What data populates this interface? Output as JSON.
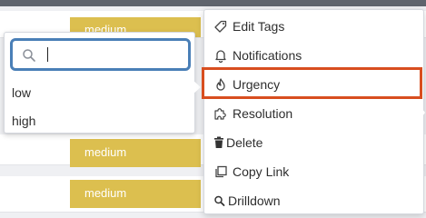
{
  "background_rows": {
    "badges": [
      "medium",
      "medium",
      "medium"
    ]
  },
  "urgency_dropdown": {
    "search": {
      "value": "",
      "placeholder": ""
    },
    "options": [
      "low",
      "high"
    ]
  },
  "context_menu": {
    "items": [
      {
        "label": "Edit Tags",
        "icon": "tag-icon"
      },
      {
        "label": "Notifications",
        "icon": "bell-icon"
      },
      {
        "label": "Urgency",
        "icon": "flame-icon"
      },
      {
        "label": "Resolution",
        "icon": "puzzle-icon"
      },
      {
        "label": "Delete",
        "icon": "trash-icon"
      },
      {
        "label": "Copy Link",
        "icon": "copy-icon"
      },
      {
        "label": "Drilldown",
        "icon": "search-icon"
      }
    ],
    "highlighted_item": "Urgency"
  },
  "colors": {
    "badge": "#dcbf4f",
    "focus_ring": "#4a7fb7",
    "highlight_border": "#d84e1f",
    "topbar": "#5f646d"
  }
}
